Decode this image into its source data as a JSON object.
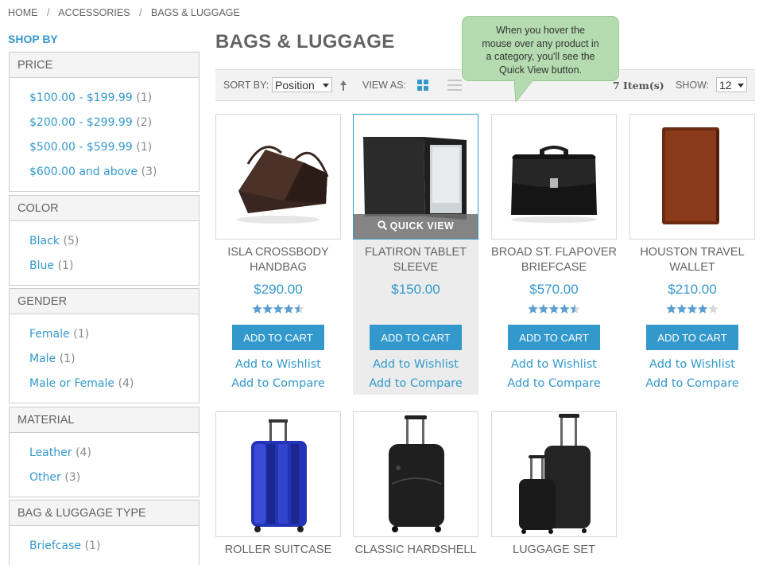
{
  "breadcrumb": [
    "HOME",
    "ACCESSORIES",
    "BAGS & LUGGAGE"
  ],
  "sidebar": {
    "title": "SHOP BY",
    "sections": [
      {
        "title": "PRICE",
        "items": [
          {
            "label": "$100.00 - $199.99",
            "count": "(1)"
          },
          {
            "label": "$200.00 - $299.99",
            "count": "(2)"
          },
          {
            "label": "$500.00 - $599.99",
            "count": "(1)"
          },
          {
            "label": "$600.00 and above",
            "count": "(3)"
          }
        ]
      },
      {
        "title": "COLOR",
        "items": [
          {
            "label": "Black",
            "count": "(5)"
          },
          {
            "label": "Blue",
            "count": "(1)"
          }
        ]
      },
      {
        "title": "GENDER",
        "items": [
          {
            "label": "Female",
            "count": "(1)"
          },
          {
            "label": "Male",
            "count": "(1)"
          },
          {
            "label": "Male or Female",
            "count": "(4)"
          }
        ]
      },
      {
        "title": "MATERIAL",
        "items": [
          {
            "label": "Leather",
            "count": "(4)"
          },
          {
            "label": "Other",
            "count": "(3)"
          }
        ]
      },
      {
        "title": "BAG & LUGGAGE TYPE",
        "items": [
          {
            "label": "Briefcase",
            "count": "(1)"
          }
        ]
      }
    ]
  },
  "main": {
    "title": "BAGS & LUGGAGE",
    "toolbar": {
      "sort_label": "SORT BY:",
      "sort_value": "Position",
      "view_label": "VIEW AS:",
      "item_count": "7 Item(s)",
      "show_label": "SHOW:",
      "show_value": "12"
    },
    "tooltip": "When you hover the mouse over any product in a category, you'll see the Quick View button.",
    "quick_view_label": "QUICK VIEW",
    "add_to_cart_label": "ADD TO CART",
    "wishlist_label": "Add to Wishlist",
    "compare_label": "Add to Compare",
    "products": [
      {
        "name": "ISLA CROSSBODY HANDBAG",
        "price": "$290.00",
        "rating": 0.9,
        "image": "crossbody-bag"
      },
      {
        "name": "FLATIRON TABLET SLEEVE",
        "price": "$150.00",
        "rating": null,
        "image": "tablet-sleeve"
      },
      {
        "name": "BROAD ST. FLAPOVER BRIEFCASE",
        "price": "$570.00",
        "rating": 0.9,
        "image": "briefcase"
      },
      {
        "name": "HOUSTON TRAVEL WALLET",
        "price": "$210.00",
        "rating": 0.8,
        "image": "wallet"
      },
      {
        "name": "ROLLER SUITCASE",
        "price": "",
        "rating": null,
        "image": "blue-suitcase"
      },
      {
        "name": "CLASSIC HARDSHELL",
        "price": "",
        "rating": null,
        "image": "black-suitcase"
      },
      {
        "name": "LUGGAGE SET",
        "price": "",
        "rating": null,
        "image": "luggage-set"
      }
    ]
  },
  "colors": {
    "accent": "#3399cc",
    "tooltip_bg": "#b5dcb0",
    "star": "#5a9fd0"
  }
}
